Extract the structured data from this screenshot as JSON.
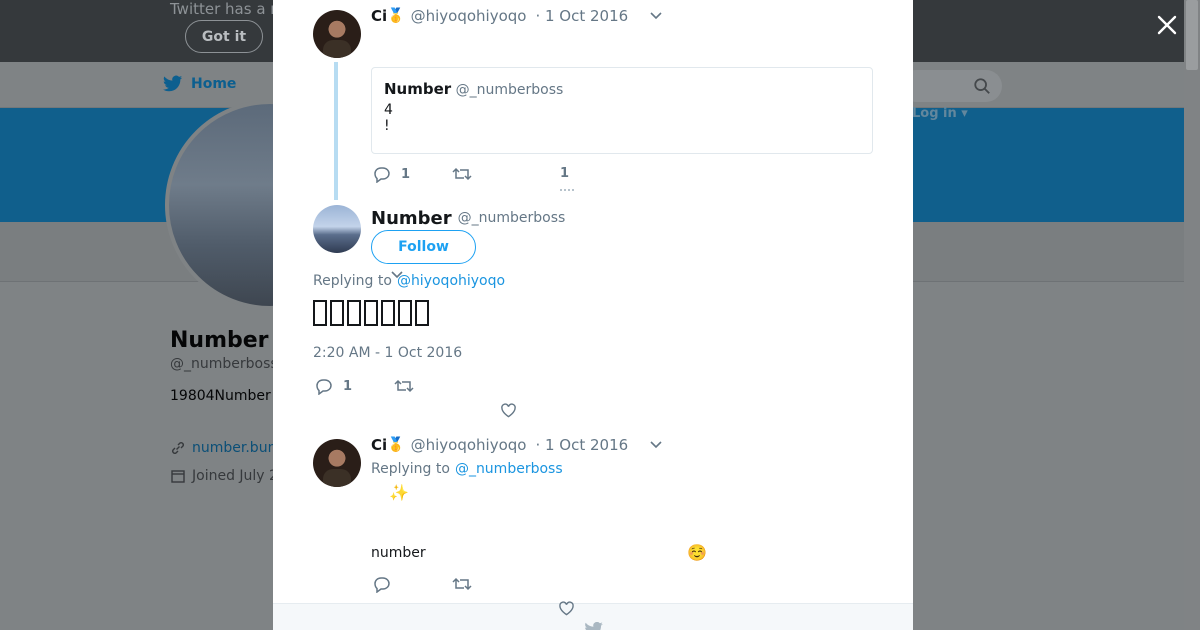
{
  "background": {
    "notice_text": "Twitter has a n",
    "got_it_label": "Got it",
    "nav_home_label": "Home",
    "login_label": "Log in",
    "profile_name": "Number",
    "profile_handle": "@_numberboss",
    "profile_bio": "19804Number",
    "profile_link": "number.bun",
    "profile_joined": "Joined July 2"
  },
  "thread": {
    "tweet1": {
      "name": "Ci",
      "badge_emoji": "🥇",
      "handle": "@hiyoqohiyoqo",
      "date": "· 1 Oct 2016",
      "quote": {
        "name": "Number",
        "handle": "@_numberboss",
        "line1": "4",
        "line2": "!"
      },
      "reply_count": "1",
      "like_count": "1"
    },
    "main_tweet": {
      "name": "Number",
      "handle": "@_numberboss",
      "follow_label": "Follow",
      "replying_to_label": "Replying to",
      "replying_to_handle": "@hiyoqohiyoqo",
      "time": "2:20 AM - 1 Oct 2016",
      "reply_count": "1"
    },
    "tweet3": {
      "name": "Ci",
      "badge_emoji": "🥇",
      "handle": "@hiyoqohiyoqo",
      "date": "· 1 Oct 2016",
      "replying_to_label": "Replying to",
      "replying_to_handle": "@_numberboss",
      "sparkle_emoji": "✨",
      "body_text": "number",
      "blush_emoji": "☺️"
    }
  },
  "colors": {
    "accent": "#1da1f2",
    "muted": "#657786",
    "thread_line": "#b7dcf2"
  }
}
